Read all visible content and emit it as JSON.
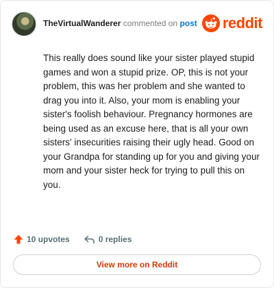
{
  "header": {
    "username": "TheVirtualWanderer",
    "commented": "commented on",
    "post_link": "post",
    "brand_name": "reddit"
  },
  "comment": {
    "body": "This really does sound like your sister played stupid games and won a stupid prize. OP, this is not your problem, this was her problem and she wanted to drag you into it. Also, your mom is enabling your sister's foolish behaviour. Pregnancy hormones are being used as an excuse here, that is all your own sisters' insecurities raising their ugly head. Good on your Grandpa for standing up for you and giving your mom and your sister heck for trying to pull this on you."
  },
  "actions": {
    "upvotes_label": "10 upvotes",
    "replies_label": "0 replies"
  },
  "footer": {
    "view_more_label": "View more on Reddit"
  },
  "colors": {
    "brand": "#ff4500",
    "link": "#0079d3",
    "view_more_text": "#d93a00",
    "action_text": "#576f76"
  },
  "icons": {
    "upvote": "upvote-arrow-icon",
    "reply": "reply-arrow-icon",
    "brand": "reddit-snoo-icon"
  }
}
